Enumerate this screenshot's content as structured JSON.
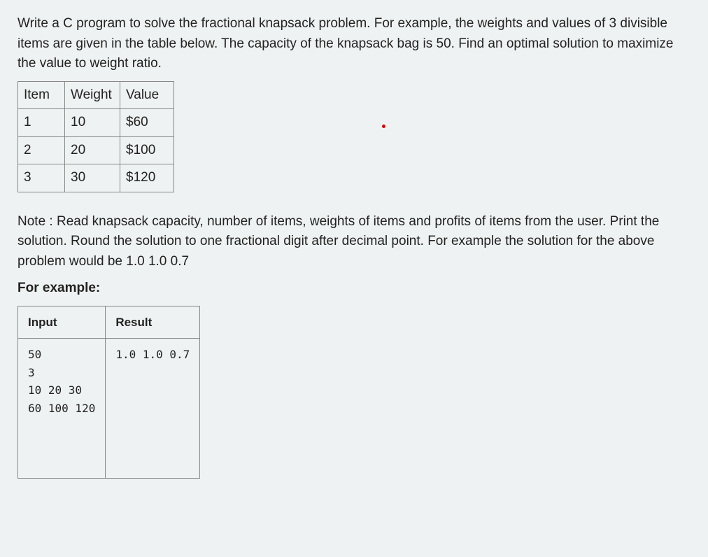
{
  "intro": "Write a C program to solve the fractional knapsack problem. For example, the weights and values of 3 divisible items are given in the table below. The capacity of the knapsack bag is 50. Find an optimal solution to maximize the value to weight ratio.",
  "items_table": {
    "headers": {
      "item": "Item",
      "weight": "Weight",
      "value": "Value"
    },
    "rows": [
      {
        "item": "1",
        "weight": "10",
        "value": "$60"
      },
      {
        "item": "2",
        "weight": "20",
        "value": "$100"
      },
      {
        "item": "3",
        "weight": "30",
        "value": "$120"
      }
    ]
  },
  "note": "Note : Read knapsack capacity, number of items, weights of items and profits of items from the user. Print the solution. Round the solution to one fractional digit after decimal point. For example the solution for the above problem would be 1.0 1.0 0.7",
  "for_example": "For example:",
  "example_table": {
    "headers": {
      "input": "Input",
      "result": "Result"
    },
    "input_text": "50\n3\n10 20 30\n60 100 120\n\n\n\n",
    "result_text": "1.0 1.0 0.7"
  }
}
